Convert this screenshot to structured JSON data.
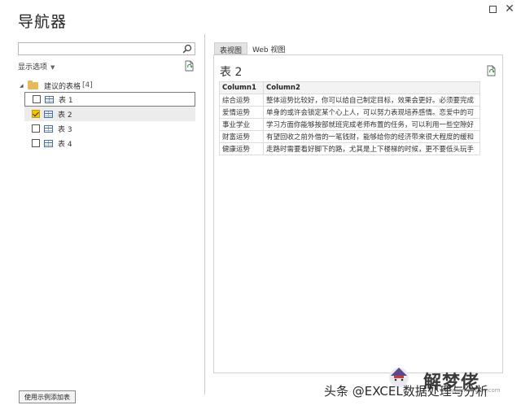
{
  "window": {
    "title": "导航器"
  },
  "left_pane": {
    "search": {
      "value": "",
      "placeholder": ""
    },
    "display_options_label": "显示选项",
    "tree": {
      "root_label": "建议的表格",
      "root_count": "[4]",
      "items": [
        {
          "label": "表 1",
          "checked": false
        },
        {
          "label": "表 2",
          "checked": true
        },
        {
          "label": "表 3",
          "checked": false
        },
        {
          "label": "表 4",
          "checked": false
        }
      ]
    },
    "add_example_button": "使用示例添加表"
  },
  "right_pane": {
    "tabs": [
      {
        "label": "表视图",
        "active": true
      },
      {
        "label": "Web 视图",
        "active": false
      }
    ],
    "preview_title": "表 2",
    "table": {
      "headers": [
        "Column1",
        "Column2"
      ],
      "rows": [
        [
          "综合运势",
          "整体运势比较好，你可以给自己制定目标，效果会更好。必须要完成"
        ],
        [
          "爱情运势",
          "单身的或许会锁定某个心上人，可以努力表现培养感情。恋爱中的可"
        ],
        [
          "事业学业",
          "学习方面你能够按部就班完成老师布置的任务，可以利用一些空隙好"
        ],
        [
          "财富运势",
          "有望回收之前外借的一笔钱财，能够给你的经济带来很大程度的缓和"
        ],
        [
          "健康运势",
          "走路时需要看好脚下的路，尤其是上下楼梯的时候，更不要低头玩手"
        ]
      ]
    }
  },
  "watermark": {
    "text": "头条 @EXCEL数据处理与分析",
    "brand": "解梦佬",
    "url": "www.jiemenglao.com"
  },
  "colors": {
    "checkbox_checked": "#f5c400",
    "folder": "#e6b95b",
    "table_icon": "#4a6fa5"
  }
}
